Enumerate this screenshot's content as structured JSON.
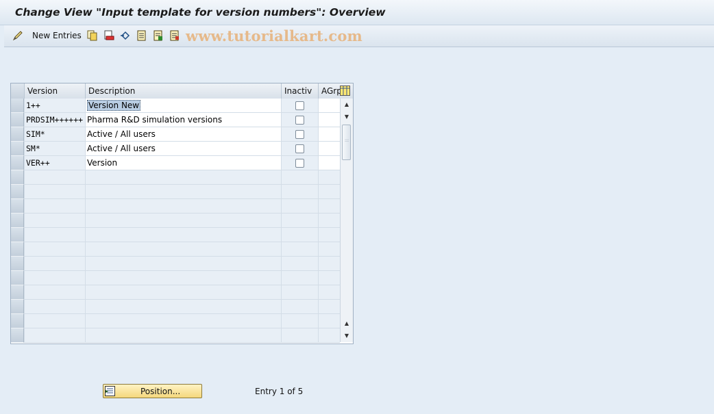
{
  "title": "Change View \"Input template for version numbers\": Overview",
  "toolbar": {
    "new_entries_label": "New Entries",
    "icons": [
      "pencil-glasses-icon",
      "copy-icon",
      "delete-icon",
      "undo-icon",
      "select-all-icon",
      "select-block-icon",
      "deselect-all-icon"
    ],
    "watermark": "www.tutorialkart.com"
  },
  "table": {
    "headers": [
      "Version",
      "Description",
      "Inactiv",
      "AGrp"
    ],
    "rows": [
      {
        "version": "1++",
        "description": "Version New",
        "inactive": false,
        "agrp": ""
      },
      {
        "version": "PRDSIM++++++",
        "description": "Pharma R&D simulation versions",
        "inactive": false,
        "agrp": ""
      },
      {
        "version": "SIM*",
        "description": "Active / All users",
        "inactive": false,
        "agrp": ""
      },
      {
        "version": "SM*",
        "description": "Active / All users",
        "inactive": false,
        "agrp": ""
      },
      {
        "version": "VER++",
        "description": "Version",
        "inactive": false,
        "agrp": ""
      }
    ]
  },
  "footer": {
    "position_button_label": "Position...",
    "entry_counter": "Entry 1 of 5"
  },
  "colors": {
    "accent_button": "#f4d77c",
    "background": "#e4edf6",
    "watermark": "#e6b98a"
  }
}
